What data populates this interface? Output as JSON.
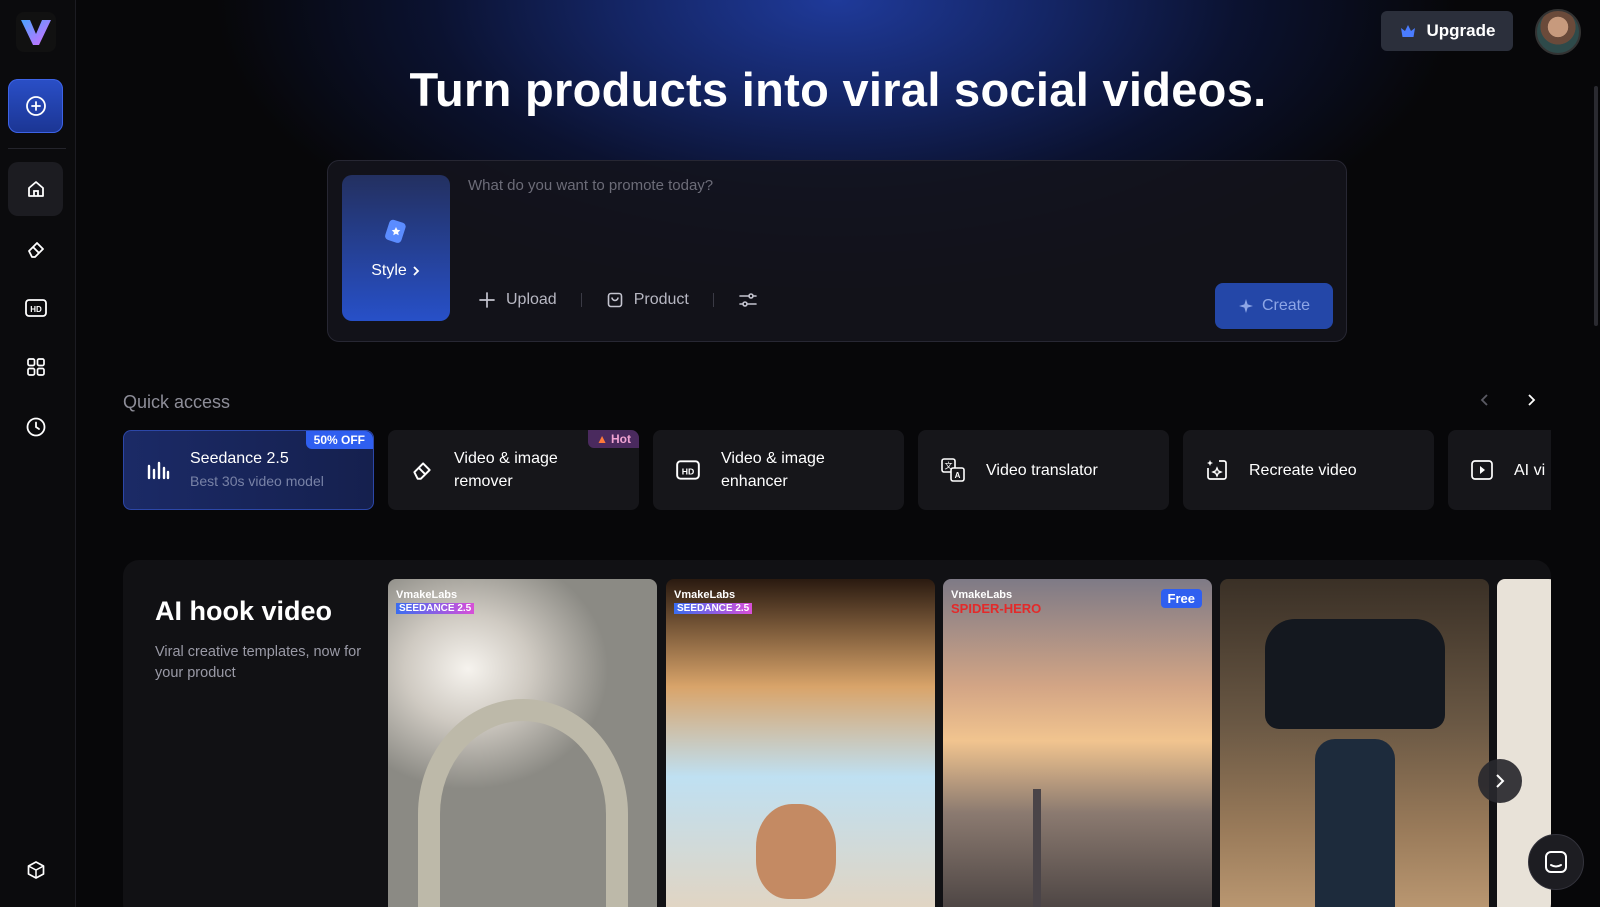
{
  "header": {
    "upgrade_label": "Upgrade"
  },
  "hero": {
    "headline": "Turn products into viral social videos."
  },
  "prompt": {
    "placeholder": "What do you want to promote today?",
    "style_label": "Style",
    "upload_label": "Upload",
    "product_label": "Product",
    "create_label": "Create"
  },
  "quick_access": {
    "title": "Quick access",
    "items": [
      {
        "label": "Seedance 2.5",
        "sub": "Best 30s video model",
        "badge": "50% OFF",
        "icon": "bars-chart-icon"
      },
      {
        "label": "Video & image remover",
        "badge": "Hot",
        "icon": "eraser-icon"
      },
      {
        "label": "Video & image enhancer",
        "icon": "hd-icon"
      },
      {
        "label": "Video translator",
        "icon": "translate-icon"
      },
      {
        "label": "Recreate video",
        "icon": "recreate-icon"
      },
      {
        "label": "AI vi",
        "icon": "play-icon"
      }
    ]
  },
  "hook": {
    "title": "AI hook video",
    "description": "Viral creative templates, now for your product",
    "thumbs": [
      {
        "brand": "VmakeLabs",
        "tag": "SEEDANCE 2.5"
      },
      {
        "brand": "VmakeLabs",
        "tag": "SEEDANCE 2.5"
      },
      {
        "brand": "VmakeLabs",
        "tag": "SPIDER-HERO",
        "free": "Free"
      },
      {
        "brand": "",
        "tag": ""
      }
    ]
  },
  "colors": {
    "accent": "#2f5ff0",
    "background": "#070709",
    "card": "#16161a"
  }
}
